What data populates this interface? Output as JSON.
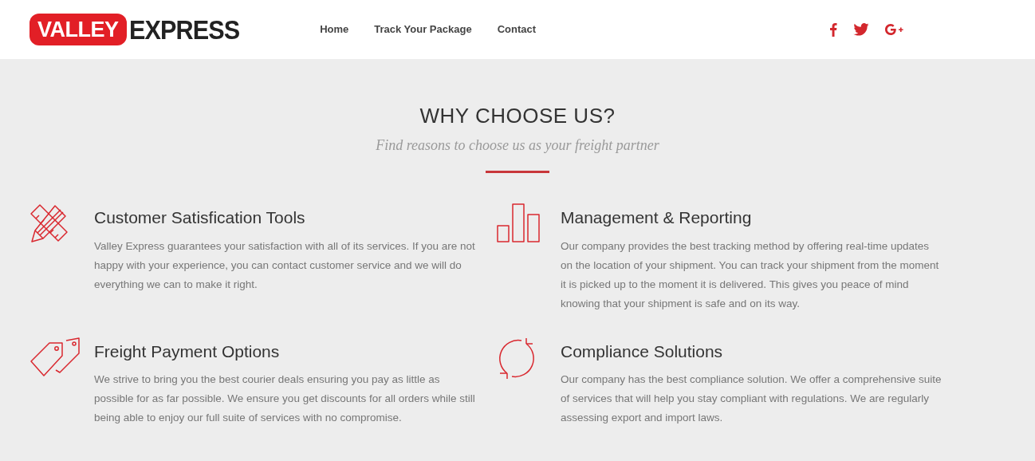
{
  "logo": {
    "badge": "VALLEY",
    "word": "EXPRESS"
  },
  "nav": [
    {
      "label": "Home"
    },
    {
      "label": "Track Your Package"
    },
    {
      "label": "Contact"
    }
  ],
  "section": {
    "title": "WHY CHOOSE US?",
    "subtitle": "Find reasons to choose us as your freight partner"
  },
  "features": [
    {
      "title": "Customer Satisfication Tools",
      "text": "Valley Express guarantees your satisfaction with all of its services. If you are not happy with your experience, you can contact customer service and we will do everything we can to make it right."
    },
    {
      "title": "Management & Reporting",
      "text": "Our company provides the best tracking method by offering real-time updates on the location of your shipment. You can track your shipment from the moment it is picked up to the moment it is delivered. This gives you peace of mind knowing that your shipment is safe and on its way."
    },
    {
      "title": "Freight Payment Options",
      "text": "We strive to bring you the best courier deals ensuring you pay as little as possible for as far possible. We ensure you get discounts for all orders while still being able to enjoy our full suite of services with no compromise."
    },
    {
      "title": "Compliance Solutions",
      "text": "Our company has the best compliance solution. We offer a comprehensive suite of services that will help you stay compliant with regulations. We are regularly assessing export and import laws."
    }
  ]
}
